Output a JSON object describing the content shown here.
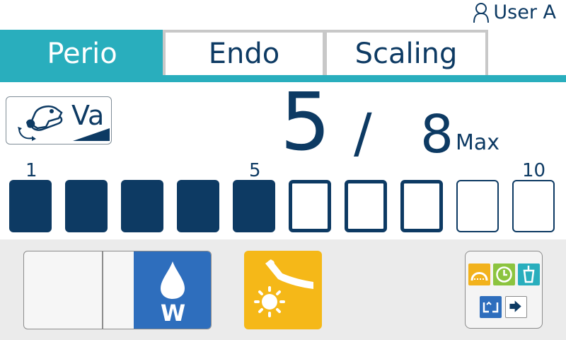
{
  "user": {
    "name": "User A",
    "icon": "user-icon"
  },
  "tabs": [
    {
      "label": "Perio",
      "active": true
    },
    {
      "label": "Endo",
      "active": false
    },
    {
      "label": "Scaling",
      "active": false
    }
  ],
  "mode": {
    "label": "Va",
    "icon": "handpiece-icon"
  },
  "level": {
    "current": "5",
    "separator": "/",
    "max": "8",
    "max_label": "Max",
    "value": 5,
    "maximum": 8,
    "scale_max": 10
  },
  "scale": {
    "tick_start": "1",
    "tick_mid": "5",
    "tick_end": "10"
  },
  "controls": {
    "water": {
      "label": "W",
      "icon": "water-drop-icon",
      "color": "#2e6ebd"
    },
    "light": {
      "icon": "handpiece-light-icon",
      "color": "#f5b818"
    },
    "menu_icons": [
      "arch-icon",
      "timer-icon",
      "cup-icon",
      "swap-icon",
      "exit-icon"
    ]
  },
  "colors": {
    "accent": "#29aebd",
    "primary": "#0d3a63"
  }
}
